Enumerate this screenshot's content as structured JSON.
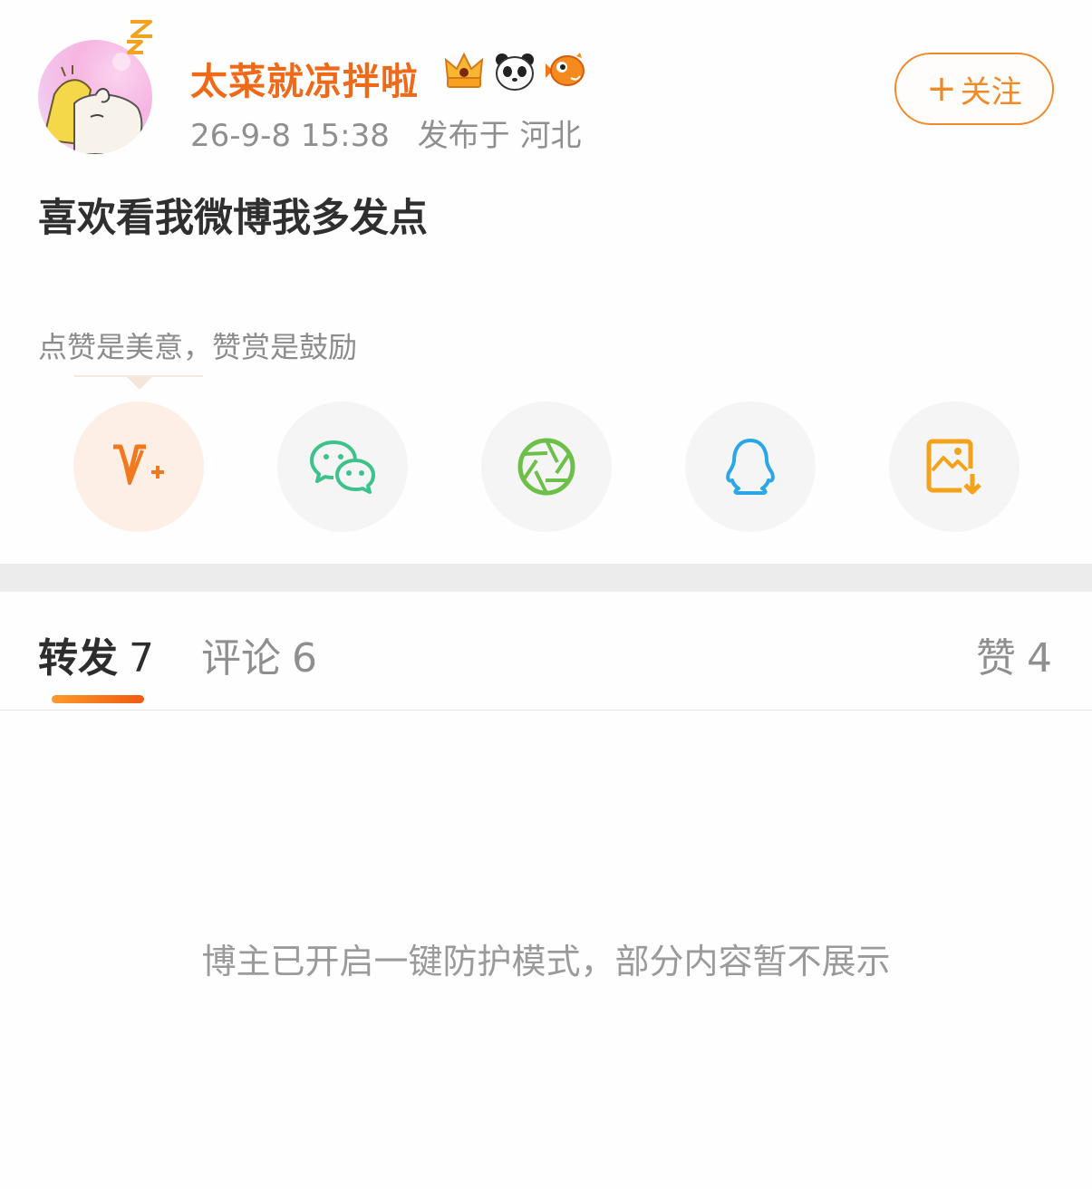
{
  "post": {
    "author": {
      "name": "太菜就凉拌啦",
      "badges": [
        "crown-badge-icon",
        "panda-badge-icon",
        "fish-badge-icon"
      ]
    },
    "time": "26-9-8 15:38",
    "location": "发布于 河北",
    "follow": {
      "plus": "+",
      "label": "关注"
    },
    "text": "喜欢看我微博我多发点"
  },
  "reward": {
    "tip": "点赞是美意，赞赏是鼓励"
  },
  "share": {
    "items": [
      "v-plus-reward-icon",
      "wechat-icon",
      "moments-icon",
      "qq-icon",
      "save-image-icon"
    ]
  },
  "tabs": {
    "repost": {
      "label": "转发",
      "count": "7"
    },
    "comment": {
      "label": "评论",
      "count": "6"
    },
    "like": {
      "label": "赞",
      "count": "4"
    }
  },
  "notice": "博主已开启一键防护模式，部分内容暂不展示",
  "colors": {
    "accent": "#ef6a18",
    "follow": "#ef8a2a",
    "wechat": "#3cc28a",
    "moments": "#6cc04a",
    "qq": "#2ba6e6",
    "save": "#f4a21a"
  }
}
